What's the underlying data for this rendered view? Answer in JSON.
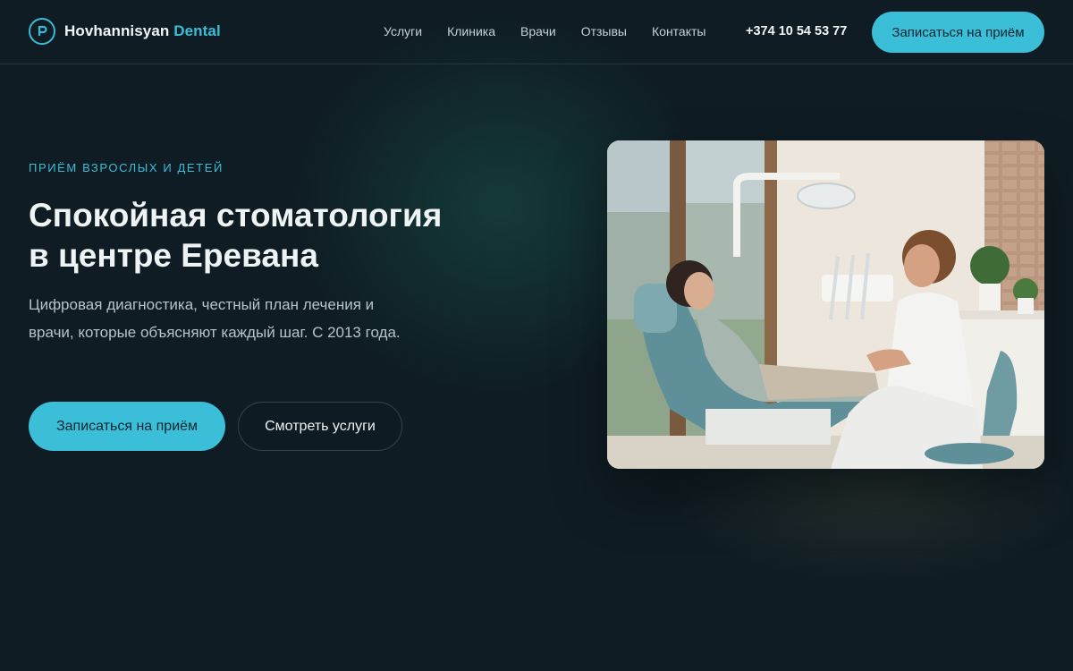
{
  "brand": {
    "name_main": "Hovhannisyan",
    "name_accent": "Dental",
    "logo_letter": "P"
  },
  "nav": {
    "items": [
      "Услуги",
      "Клиника",
      "Врачи",
      "Отзывы",
      "Контакты"
    ]
  },
  "header": {
    "phone": "+374 10 54 53 77",
    "cta_label": "Записаться на приём"
  },
  "hero": {
    "eyebrow": "ПРИЁМ ВЗРОСЛЫХ И ДЕТЕЙ",
    "title_line1": "Спокойная стоматология",
    "title_line2": "в центре Еревана",
    "lead": "Цифровая диагностика, честный план лечения и врачи, которые объясняют каждый шаг. С 2013 года.",
    "primary_cta": "Записаться на приём",
    "secondary_cta": "Смотреть услуги"
  },
  "colors": {
    "accent": "#3bbfd8",
    "background": "#0f1c23",
    "text": "#eef3f4"
  },
  "icons": {
    "logo": "p-circle-icon"
  }
}
